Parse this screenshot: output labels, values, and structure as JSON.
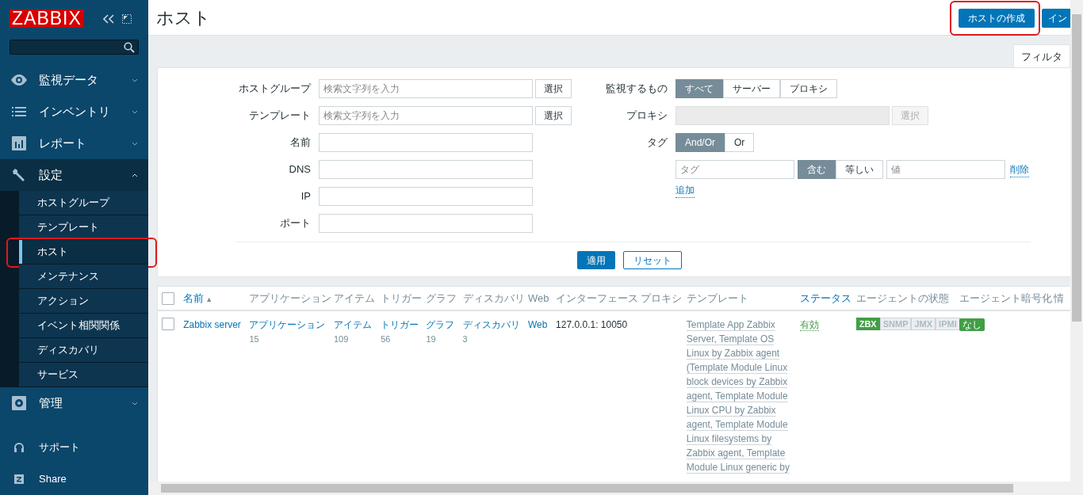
{
  "sidebar": {
    "logo": "ZABBIX",
    "menu": [
      {
        "label": "監視データ",
        "kind": "eye",
        "expanded": false
      },
      {
        "label": "インベントリ",
        "kind": "list",
        "expanded": false
      },
      {
        "label": "レポート",
        "kind": "chart",
        "expanded": false
      },
      {
        "label": "設定",
        "kind": "wrench",
        "expanded": true,
        "children": [
          {
            "label": "ホストグループ",
            "selected": false,
            "highlighted": false
          },
          {
            "label": "テンプレート",
            "selected": false,
            "highlighted": false
          },
          {
            "label": "ホスト",
            "selected": true,
            "highlighted": true
          },
          {
            "label": "メンテナンス",
            "selected": false,
            "highlighted": false
          },
          {
            "label": "アクション",
            "selected": false,
            "highlighted": false
          },
          {
            "label": "イベント相関関係",
            "selected": false,
            "highlighted": false
          },
          {
            "label": "ディスカバリ",
            "selected": false,
            "highlighted": false
          },
          {
            "label": "サービス",
            "selected": false,
            "highlighted": false
          }
        ]
      },
      {
        "label": "管理",
        "kind": "gear",
        "expanded": false
      }
    ],
    "footer": [
      {
        "label": "サポート",
        "kind": "headset"
      },
      {
        "label": "Share",
        "kind": "z"
      }
    ]
  },
  "page": {
    "title": "ホスト",
    "buttons": [
      {
        "label": "ホストの作成",
        "highlighted": true
      },
      {
        "label": "イン",
        "highlighted": false
      }
    ]
  },
  "filter": {
    "tab": "フィルタ",
    "fields": [
      {
        "label": "ホストグループ",
        "kind": "multiselect",
        "placeholder": "検索文字列を入力",
        "button": "選択"
      },
      {
        "label": "テンプレート",
        "kind": "multiselect",
        "placeholder": "検索文字列を入力",
        "button": "選択"
      },
      {
        "label": "名前",
        "kind": "text"
      },
      {
        "label": "DNS",
        "kind": "text"
      },
      {
        "label": "IP",
        "kind": "text"
      },
      {
        "label": "ポート",
        "kind": "text"
      }
    ],
    "monitored_by": {
      "label": "監視するもの",
      "options": [
        {
          "label": "すべて",
          "selected": true
        },
        {
          "label": "サーバー",
          "selected": false
        },
        {
          "label": "プロキシ",
          "selected": false
        }
      ]
    },
    "proxy": {
      "label": "プロキシ",
      "disabled": true,
      "button": "選択"
    },
    "tags": {
      "label": "タグ",
      "operators": [
        {
          "label": "And/Or",
          "selected": true
        },
        {
          "label": "Or",
          "selected": false
        }
      ],
      "rows": [
        {
          "tag_placeholder": "タグ",
          "operators": [
            {
              "label": "含む",
              "selected": true
            },
            {
              "label": "等しい",
              "selected": false
            }
          ],
          "value_placeholder": "値",
          "remove": "削除"
        }
      ],
      "add": "追加"
    },
    "apply": "適用",
    "reset": "リセット"
  },
  "table": {
    "select_all_checked": false,
    "columns": [
      {
        "label": "名前",
        "sortable": true,
        "sort_mark": "▲"
      },
      {
        "label": "アプリケーション",
        "sortable": false
      },
      {
        "label": "アイテム",
        "sortable": false
      },
      {
        "label": "トリガー",
        "sortable": false
      },
      {
        "label": "グラフ",
        "sortable": false
      },
      {
        "label": "ディスカバリ",
        "sortable": false
      },
      {
        "label": "Web",
        "sortable": false
      },
      {
        "label": "インターフェース",
        "sortable": false
      },
      {
        "label": "プロキシ",
        "sortable": false
      },
      {
        "label": "テンプレート",
        "sortable": false
      },
      {
        "label": "ステータス",
        "sortable": true
      },
      {
        "label": "エージェントの状態",
        "sortable": false
      },
      {
        "label": "エージェント暗号化",
        "sortable": false
      },
      {
        "label": "情",
        "sortable": false
      }
    ],
    "rows": [
      {
        "checked": false,
        "name": "Zabbix server",
        "links": [
          {
            "label": "アプリケーション",
            "count": "15"
          },
          {
            "label": "アイテム",
            "count": "109"
          },
          {
            "label": "トリガー",
            "count": "56"
          },
          {
            "label": "グラフ",
            "count": "19"
          },
          {
            "label": "ディスカバリ",
            "count": "3"
          },
          {
            "label": "Web"
          }
        ],
        "interface": "127.0.0.1: 10050",
        "templates": "Template App Zabbix Server, Template OS Linux by Zabbix agent (Template Module Linux block devices by Zabbix agent, Template Module Linux CPU by Zabbix agent, Template Module Linux filesystems by Zabbix agent, Template Module Linux generic by",
        "status": {
          "label": "有効",
          "enabled": true
        },
        "availability": [
          {
            "label": "ZBX",
            "on": true
          },
          {
            "label": "SNMP",
            "on": false
          },
          {
            "label": "JMX",
            "on": false
          },
          {
            "label": "IPMI",
            "on": false
          }
        ],
        "encryption": "なし"
      }
    ]
  }
}
